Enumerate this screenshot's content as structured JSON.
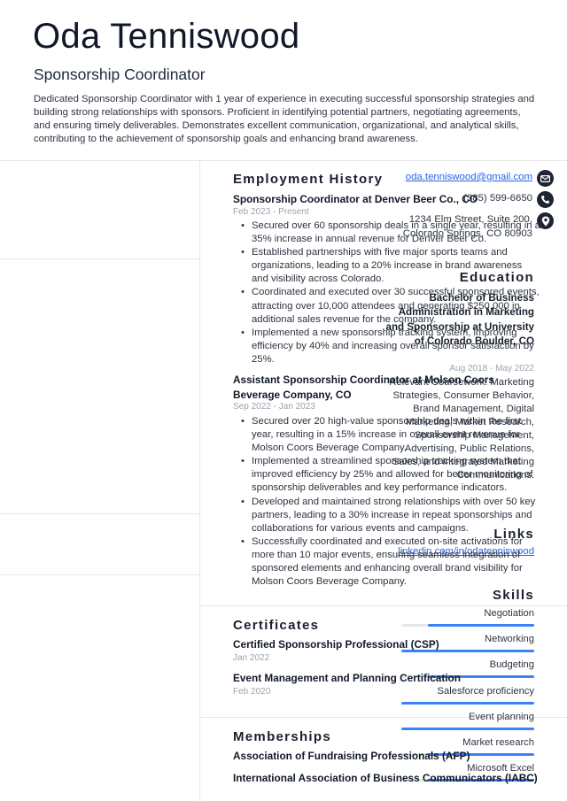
{
  "header": {
    "name": "Oda Tenniswood",
    "title": "Sponsorship Coordinator",
    "summary": "Dedicated Sponsorship Coordinator with 1 year of experience in executing successful sponsorship strategies and building strong relationships with sponsors. Proficient in identifying potential partners, negotiating agreements, and ensuring timely deliverables. Demonstrates excellent communication, organizational, and analytical skills, contributing to the achievement of sponsorship goals and enhancing brand awareness."
  },
  "contact": {
    "email": "oda.tenniswood@gmail.com",
    "email_icon": "envelope-icon",
    "phone": "(385) 599-6650",
    "phone_icon": "phone-icon",
    "address_line1": "1234 Elm Street, Suite 200,",
    "address_line2": "Colorado Springs, CO 80903",
    "address_icon": "location-pin-icon"
  },
  "education": {
    "title": "Education",
    "degree": "Bachelor of Business Administration in Marketing and Sponsorship at University of Colorado Boulder, CO",
    "dates": "Aug 2018 - May 2022",
    "description": "Relevant Coursework: Marketing Strategies, Consumer Behavior, Brand Management, Digital Marketing, Market Research, Sponsorship Management, Advertising, Public Relations, Sales, and Integrated Marketing Communications."
  },
  "links": {
    "title": "Links",
    "items": [
      "linkedin.com/in/odatenniswood"
    ]
  },
  "skills": {
    "title": "Skills",
    "accent_color": "#3b82f6",
    "items": [
      {
        "label": "Negotiation",
        "level": 0.8
      },
      {
        "label": "Networking",
        "level": 1.0
      },
      {
        "label": "Budgeting",
        "level": 0.8
      },
      {
        "label": "Salesforce proficiency",
        "level": 1.0
      },
      {
        "label": "Event planning",
        "level": 1.0
      },
      {
        "label": "Market research",
        "level": 0.8
      },
      {
        "label": "Microsoft Excel",
        "level": 0.8
      }
    ]
  },
  "employment": {
    "title": "Employment History",
    "jobs": [
      {
        "heading": "Sponsorship Coordinator at Denver Beer Co., CO",
        "dates": "Feb 2023 - Present",
        "bullets": [
          "Secured over 60 sponsorship deals in a single year, resulting in a 35% increase in annual revenue for Denver Beer Co.",
          "Established partnerships with five major sports teams and organizations, leading to a 20% increase in brand awareness and visibility across Colorado.",
          "Coordinated and executed over 30 successful sponsored events, attracting over 10,000 attendees and generating $250,000 in additional sales revenue for the company.",
          "Implemented a new sponsorship tracking system, improving efficiency by 40% and increasing overall sponsor satisfaction by 25%."
        ]
      },
      {
        "heading": "Assistant Sponsorship Coordinator at Molson Coors Beverage Company, CO",
        "dates": "Sep 2022 - Jan 2023",
        "bullets": [
          "Secured over 20 high-value sponsorship deals within the first year, resulting in a 15% increase in overall event revenue for Molson Coors Beverage Company.",
          "Implemented a streamlined sponsorship tracking system that improved efficiency by 25% and allowed for better monitoring of sponsorship deliverables and key performance indicators.",
          "Developed and maintained strong relationships with over 50 key partners, leading to a 30% increase in repeat sponsorships and collaborations for various events and campaigns.",
          "Successfully coordinated and executed on-site activations for more than 10 major events, ensuring seamless integration of sponsored elements and enhancing overall brand visibility for Molson Coors Beverage Company."
        ]
      }
    ]
  },
  "certificates": {
    "title": "Certificates",
    "items": [
      {
        "name": "Certified Sponsorship Professional (CSP)",
        "date": "Jan 2022"
      },
      {
        "name": "Event Management and Planning Certification",
        "date": "Feb 2020"
      }
    ]
  },
  "memberships": {
    "title": "Memberships",
    "items": [
      "Association of Fundraising Professionals (AFP)",
      "International Association of Business Communicators (IABC)"
    ]
  }
}
